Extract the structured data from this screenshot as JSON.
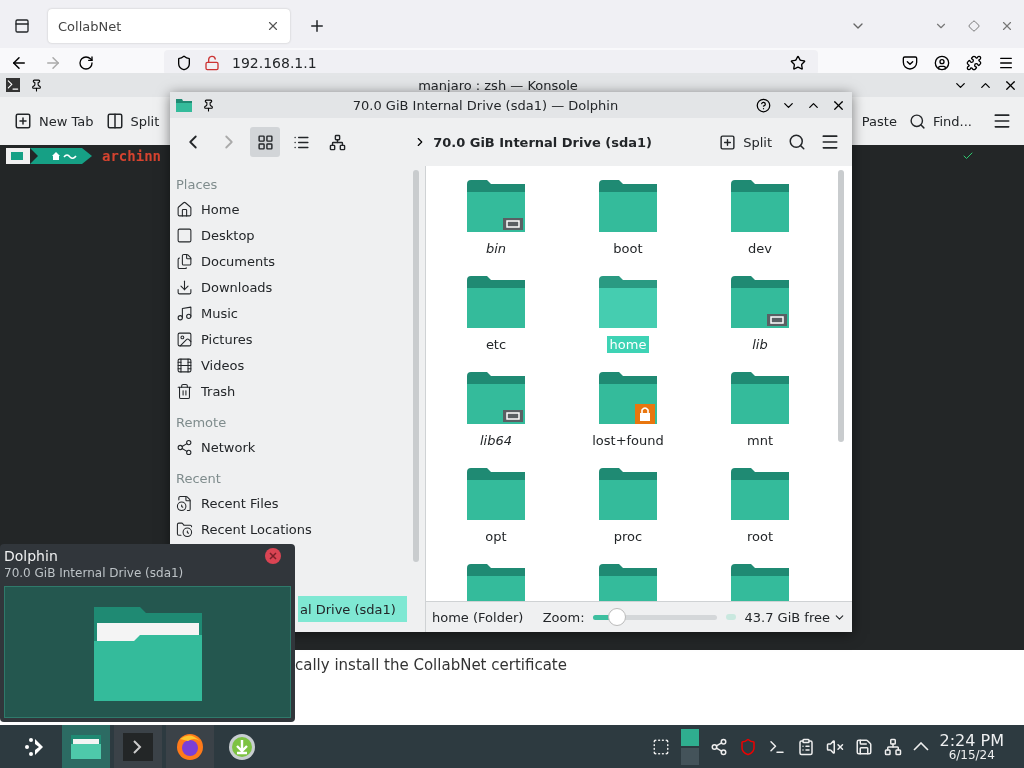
{
  "browser": {
    "tab": "CollabNet",
    "url": "192.168.1.1",
    "page_text": "cally install the CollabNet certificate"
  },
  "konsole": {
    "title": "manjaro : zsh — Konsole",
    "toolbar_left": [
      "New Tab",
      "Split"
    ],
    "toolbar_right": [
      "Paste",
      "Find..."
    ],
    "command": "archinn"
  },
  "dolphin": {
    "title": "70.0 GiB Internal Drive (sda1) — Dolphin",
    "view_modes": [
      {
        "selected": true
      },
      {
        "selected": false
      },
      {
        "selected": false
      }
    ],
    "breadcrumb": "70.0 GiB Internal Drive (sda1)",
    "split": "Split",
    "places": [
      {
        "heading": "Places",
        "items": [
          {
            "label": "Home",
            "selected": false
          },
          {
            "label": "Desktop",
            "selected": false
          },
          {
            "label": "Documents",
            "selected": false
          },
          {
            "label": "Downloads",
            "selected": false
          },
          {
            "label": "Music",
            "selected": false
          },
          {
            "label": "Pictures",
            "selected": false
          },
          {
            "label": "Videos",
            "selected": false
          },
          {
            "label": "Trash",
            "selected": false
          }
        ]
      },
      {
        "heading": "Remote",
        "items": [
          {
            "label": "Network",
            "selected": false
          }
        ]
      },
      {
        "heading": "Recent",
        "items": [
          {
            "label": "Recent Files",
            "selected": false
          },
          {
            "label": "Recent Locations",
            "selected": false
          }
        ]
      },
      {
        "items": [
          {
            "label": "al Drive (sda1)",
            "selected": true
          }
        ]
      }
    ],
    "files": [
      {
        "name": "bin",
        "selected": false,
        "kind": "link"
      },
      {
        "name": "boot",
        "selected": false,
        "kind": "folder"
      },
      {
        "name": "dev",
        "selected": false,
        "kind": "folder"
      },
      {
        "name": "etc",
        "selected": false,
        "kind": "folder"
      },
      {
        "name": "home",
        "selected": true,
        "kind": "folder"
      },
      {
        "name": "lib",
        "selected": false,
        "kind": "link"
      },
      {
        "name": "lib64",
        "selected": false,
        "kind": "link"
      },
      {
        "name": "lost+found",
        "selected": false,
        "kind": "locked"
      },
      {
        "name": "mnt",
        "selected": false,
        "kind": "folder"
      },
      {
        "name": "opt",
        "selected": false,
        "kind": "folder"
      },
      {
        "name": "proc",
        "selected": false,
        "kind": "folder"
      },
      {
        "name": "root",
        "selected": false,
        "kind": "folder"
      },
      {
        "kind": "folder"
      },
      {
        "kind": "folder"
      },
      {
        "kind": "folder"
      }
    ],
    "status": {
      "text": "home (Folder)",
      "zoom_label": "Zoom:",
      "zoom": {
        "level": 0.2
      },
      "free": "43.7 GiB free"
    }
  },
  "preview": {
    "title": "Dolphin",
    "subtitle": "70.0 GiB Internal Drive (sda1)"
  },
  "taskbar": {
    "tasks": [
      {
        "kind": "launcher"
      },
      {
        "kind": "files",
        "active": true
      },
      {
        "kind": "terminal",
        "active": false
      },
      {
        "kind": "browser",
        "active": false
      },
      {
        "kind": "updater"
      }
    ],
    "clock": {
      "time": "2:24 PM",
      "date": "6/15/24"
    }
  }
}
